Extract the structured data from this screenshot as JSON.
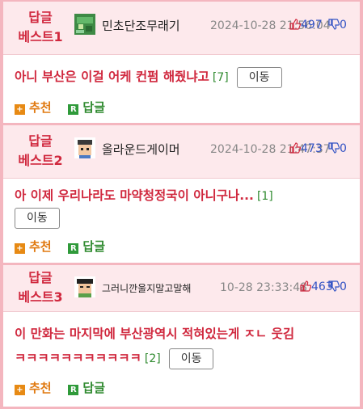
{
  "actions": {
    "recommend_label": "추천",
    "reply_label": "답글",
    "recommend_icon": "plus-icon",
    "reply_icon": "reply-r-icon"
  },
  "move_label": "이동",
  "posts": [
    {
      "best_line1": "답글",
      "best_line2": "베스트1",
      "nickname": "민초단조무래기",
      "date": "2024-10-28 21:56:04",
      "up_count": "497",
      "down_count": "0",
      "title": "아니 부산은 이걸 어케 컨펌 해줬냐고",
      "comment_count": "[7]"
    },
    {
      "best_line1": "답글",
      "best_line2": "베스트2",
      "nickname": "올라운드게이머",
      "date": "2024-10-28 21:47:37",
      "up_count": "473",
      "down_count": "0",
      "title": "아 이제 우리나라도 마약청정국이 아니구나...",
      "comment_count": "[1]"
    },
    {
      "best_line1": "답글",
      "best_line2": "베스트3",
      "nickname": "그러니깐울지말고말해",
      "date": "10-28 23:33:48",
      "up_count": "463",
      "down_count": "0",
      "title_line1": "이 만화는 마지막에 부산광역시 적혀있는게 ㅈㄴ 웃김",
      "title_line2": "ㅋㅋㅋㅋㅋㅋㅋㅋㅋㅋㅋ",
      "comment_count": "[2]"
    }
  ],
  "colors": {
    "accent_red": "#d0283e",
    "header_bg": "#fde9ec",
    "border_pink": "#f4b6bf",
    "vote_blue": "#3353c4",
    "reply_green": "#2f8a2f",
    "recommend_orange": "#e07a12"
  }
}
